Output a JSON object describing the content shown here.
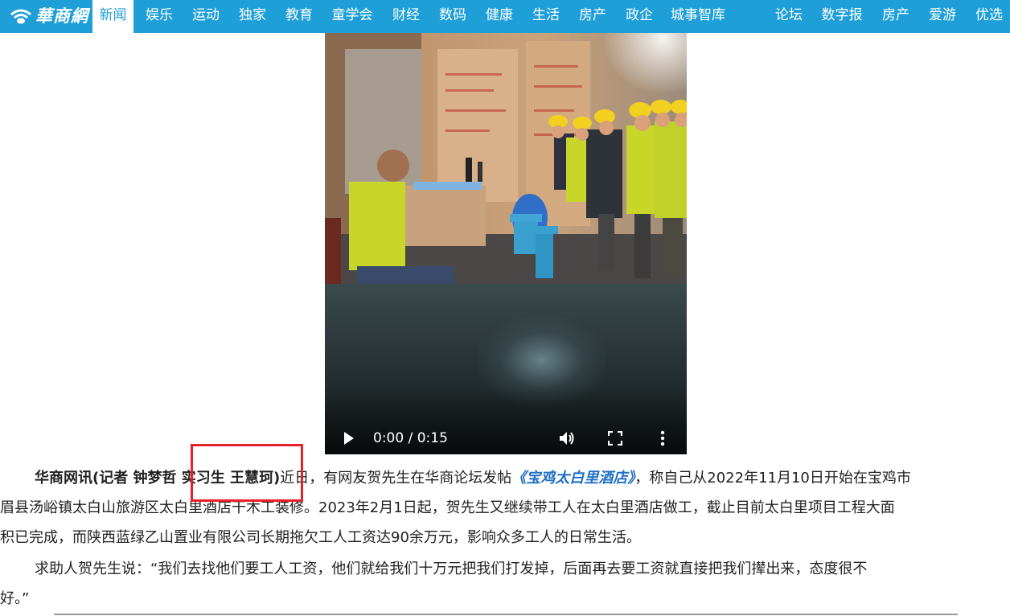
{
  "site": {
    "logo_text": "華商網",
    "brand_color": "#1f9fd7"
  },
  "nav": {
    "items": [
      {
        "label": "新闻",
        "active": true
      },
      {
        "label": "娱乐"
      },
      {
        "label": "运动"
      },
      {
        "label": "独家"
      },
      {
        "label": "教育"
      },
      {
        "label": "童学会"
      },
      {
        "label": "财经"
      },
      {
        "label": "数码"
      },
      {
        "label": "健康"
      },
      {
        "label": "生活"
      },
      {
        "label": "房产"
      },
      {
        "label": "政企"
      },
      {
        "label": "城事智库"
      },
      {
        "label": "论坛"
      },
      {
        "label": "数字报"
      },
      {
        "label": "房产"
      },
      {
        "label": "爱游"
      },
      {
        "label": "优选"
      }
    ]
  },
  "video": {
    "time_display": "0:00 / 0:15",
    "progress_fraction": 0.02,
    "icons": [
      "play-icon",
      "volume-icon",
      "fullscreen-icon",
      "more-vert-icon"
    ]
  },
  "article": {
    "p1_lead": "华商网讯(记者 钟梦哲 实习生 王慧珂)",
    "p1_a": "近日，有网友贺先生在华商论坛发帖",
    "p1_link": "《宝鸡太白里酒店》",
    "p1_b": "，称自己从2022年11月10日开始在宝鸡市",
    "p1_line2": "眉县汤峪镇太白山旅游区太白里酒店干木工装修。2023年2月1日起，贺先生又继续带工人在太白里酒店做工，截止目前太白里项目工程大面",
    "p1_line3": "积已完成，而陕西蓝绿乙山置业有限公司长期拖欠工人工资达90余万元，影响众多工人的日常生活。",
    "p2_line1": "求助人贺先生说：“我们去找他们要工人工资，他们就给我们十万元把我们打发掉，后面再去要工资就直接把我们撵出来，态度很不",
    "p2_line2": "好。”"
  },
  "annotation": {
    "highlight_color": "#e8202a"
  }
}
